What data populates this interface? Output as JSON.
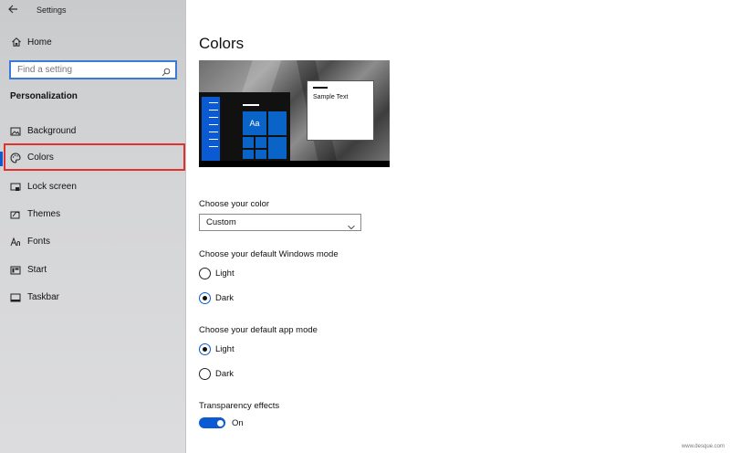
{
  "window": {
    "title": "Settings"
  },
  "sidebar": {
    "home_label": "Home",
    "search_placeholder": "Find a setting",
    "section": "Personalization",
    "items": [
      {
        "label": "Background",
        "icon": "picture-icon"
      },
      {
        "label": "Colors",
        "icon": "palette-icon",
        "active": true
      },
      {
        "label": "Lock screen",
        "icon": "lock-screen-icon"
      },
      {
        "label": "Themes",
        "icon": "themes-icon"
      },
      {
        "label": "Fonts",
        "icon": "fonts-icon"
      },
      {
        "label": "Start",
        "icon": "start-icon"
      },
      {
        "label": "Taskbar",
        "icon": "taskbar-icon"
      }
    ]
  },
  "main": {
    "title": "Colors",
    "preview": {
      "tile_text": "Aa",
      "window_text": "Sample Text"
    },
    "choose_color": {
      "label": "Choose your color",
      "value": "Custom"
    },
    "windows_mode": {
      "label": "Choose your default Windows mode",
      "options": [
        "Light",
        "Dark"
      ],
      "selected": "Dark"
    },
    "app_mode": {
      "label": "Choose your default app mode",
      "options": [
        "Light",
        "Dark"
      ],
      "selected": "Light"
    },
    "transparency": {
      "label": "Transparency effects",
      "state": "On"
    }
  },
  "watermark": "www.desque.com",
  "colors": {
    "accent": "#0a5bd3",
    "highlight_border": "#e0322e"
  }
}
